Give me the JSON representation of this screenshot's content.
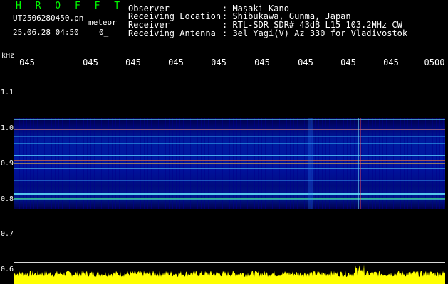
{
  "header": {
    "brand": "H R O F F T",
    "filename": "UT2506280450.pn",
    "mode_label": "meteor",
    "datetime": "25.06.28 04:50",
    "count": "0_"
  },
  "info": [
    {
      "key": "Observer",
      "value": ": Masaki Kano"
    },
    {
      "key": "Receiving Location",
      "value": ": Shibukawa, Gunma, Japan"
    },
    {
      "key": "Receiver",
      "value": ": RTL-SDR SDR# 43dB L15 103.2MHz CW"
    },
    {
      "key": "Receiving Antenna",
      "value": ": 3el Yagi(V) Az 330 for Vladivostok"
    }
  ],
  "axis": {
    "y_unit": "kHz",
    "x_ticks": [
      "045",
      "045",
      "045",
      "045",
      "045",
      "045",
      "045",
      "045",
      "045",
      "0500"
    ],
    "y_ticks": [
      "1.1",
      "1.0",
      "0.9",
      "0.8",
      "0.7",
      "0.6"
    ]
  },
  "colors": {
    "brand": "#00ff00",
    "signal_red": "#ff3030",
    "signal_cyan": "#30d0ff",
    "signal_green": "#40ff70",
    "noise_yellow": "#ffff00"
  }
}
